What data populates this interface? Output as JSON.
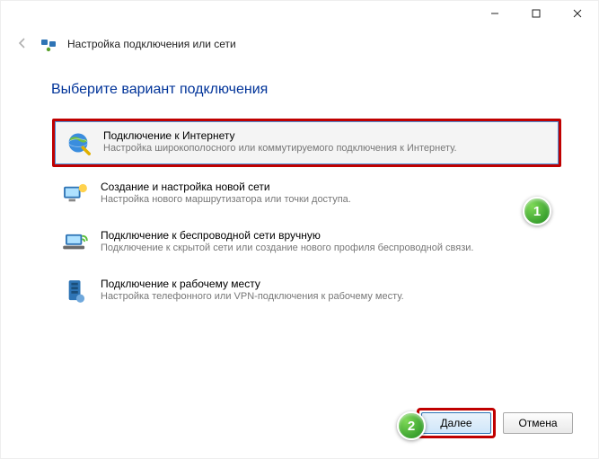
{
  "titlebar": {},
  "header": {
    "caption": "Настройка подключения или сети"
  },
  "heading": "Выберите вариант подключения",
  "options": [
    {
      "title": "Подключение к Интернету",
      "desc": "Настройка широкополосного или коммутируемого подключения к Интернету.",
      "selected": true
    },
    {
      "title": "Создание и настройка новой сети",
      "desc": "Настройка нового маршрутизатора или точки доступа.",
      "selected": false
    },
    {
      "title": "Подключение к беспроводной сети вручную",
      "desc": "Подключение к скрытой сети или создание нового профиля беспроводной связи.",
      "selected": false
    },
    {
      "title": "Подключение к рабочему месту",
      "desc": "Настройка телефонного или VPN-подключения к рабочему месту.",
      "selected": false
    }
  ],
  "footer": {
    "next": "Далее",
    "cancel": "Отмена"
  },
  "badges": {
    "one": "1",
    "two": "2"
  }
}
